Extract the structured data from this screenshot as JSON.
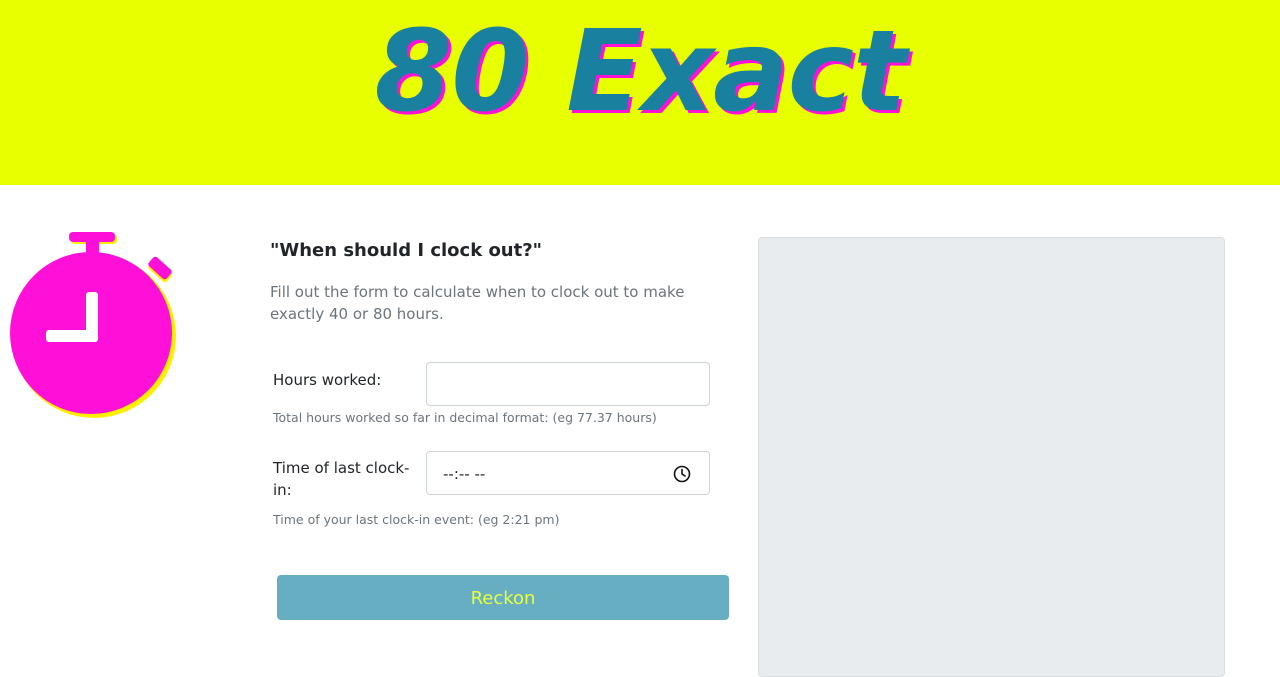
{
  "header": {
    "brand": "80 Exact",
    "background_color": "#e8ff00",
    "brand_color": "#1a80a0",
    "brand_shadow_color": "#ff10d8"
  },
  "logo": {
    "icon": "stopwatch-icon",
    "color": "#ff10d8"
  },
  "main": {
    "heading": "\"When should I clock out?\"",
    "lead": "Fill out the form to calculate when to clock out to make exactly 40 or 80 hours.",
    "form": {
      "hours": {
        "label": "Hours worked:",
        "value": "",
        "help": "Total hours worked so far in decimal format: (eg 77.37 hours)"
      },
      "time": {
        "label": "Time of last clock-in:",
        "value": "--:-- --",
        "icon": "clock-icon",
        "help": "Time of your last clock-in event: (eg 2:21 pm)"
      },
      "submit_label": "Reckon",
      "submit_color": "#67aec3",
      "submit_text_color": "#e8ff3a"
    }
  },
  "side_panel": {
    "color": "#e9ecef"
  }
}
